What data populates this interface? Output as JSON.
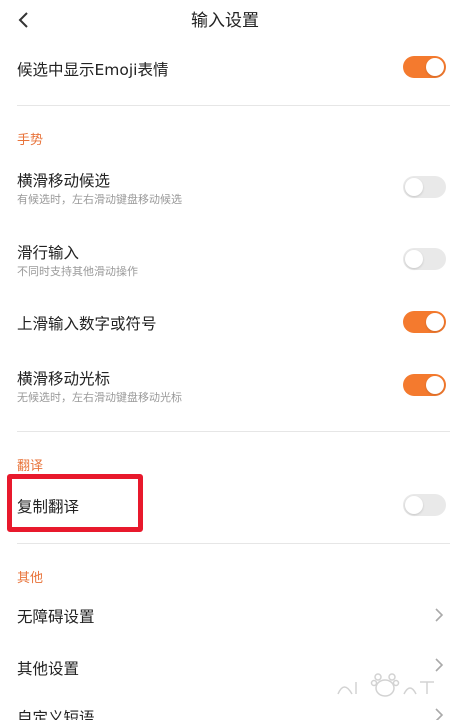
{
  "header": {
    "title": "输入设置",
    "back_icon": "chevron-left-icon"
  },
  "top_item": {
    "title": "候选中显示Emoji表情",
    "toggle": true
  },
  "sections": {
    "gesture": {
      "label": "手势",
      "items": [
        {
          "title": "横滑移动候选",
          "subtitle": "有候选时，左右滑动键盘移动候选",
          "toggle": false
        },
        {
          "title": "滑行输入",
          "subtitle": "不同时支持其他滑动操作",
          "toggle": false
        },
        {
          "title": "上滑输入数字或符号",
          "subtitle": "",
          "toggle": true
        },
        {
          "title": "横滑移动光标",
          "subtitle": "无候选时，左右滑动键盘移动光标",
          "toggle": true
        }
      ]
    },
    "translate": {
      "label": "翻译",
      "items": [
        {
          "title": "复制翻译",
          "toggle": false
        }
      ]
    },
    "other": {
      "label": "其他",
      "items": [
        {
          "title": "无障碍设置",
          "icon": "chevron-right-icon"
        },
        {
          "title": "其他设置",
          "icon": "chevron-right-icon"
        },
        {
          "title": "自定义短语",
          "icon": "chevron-right-icon"
        }
      ]
    }
  },
  "colors": {
    "accent": "#f47a2e",
    "section_label": "#e8733a",
    "toggle_off": "#e9e9e9",
    "highlight": "#e8192c"
  }
}
